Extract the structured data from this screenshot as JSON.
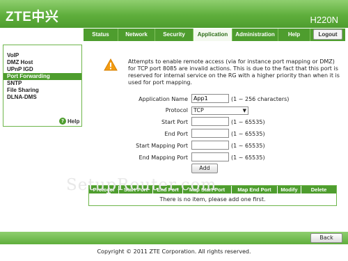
{
  "header": {
    "logo": "ZTE中兴",
    "model": "H220N"
  },
  "nav": {
    "tabs": [
      "Status",
      "Network",
      "Security",
      "Application",
      "Administration",
      "Help"
    ],
    "active": "Application",
    "logout": "Logout"
  },
  "sidebar": {
    "items": [
      "VoIP",
      "DMZ Host",
      "UPnP IGD",
      "Port Forwarding",
      "SNTP",
      "File Sharing",
      "DLNA-DMS"
    ],
    "active": "Port Forwarding",
    "help": "Help"
  },
  "warning": {
    "text": "Attempts to enable remote access (via for instance port mapping or DMZ) for TCP port 8085 are invalid actions. This is due to the fact that this port is reserved for internal service on the RG with a higher priority than when it is used for port mapping."
  },
  "form": {
    "app_name_label": "Application Name",
    "app_name_value": "App1",
    "app_name_hint": "(1 ~ 256 characters)",
    "protocol_label": "Protocol",
    "protocol_value": "TCP",
    "start_port_label": "Start Port",
    "start_port_value": "",
    "start_port_hint": "(1 ~ 65535)",
    "end_port_label": "End Port",
    "end_port_value": "",
    "end_port_hint": "(1 ~ 65535)",
    "start_map_label": "Start Mapping Port",
    "start_map_value": "",
    "start_map_hint": "(1 ~ 65535)",
    "end_map_label": "End Mapping Port",
    "end_map_value": "",
    "end_map_hint": "(1 ~ 65535)",
    "add_button": "Add"
  },
  "table": {
    "columns": [
      "Protocol",
      "Start Port",
      "End Port",
      "Map Start Port",
      "Map End Port",
      "Modify",
      "Delete"
    ],
    "empty_message": "There is no item, please add one first."
  },
  "watermark": "SetupRouter.com",
  "footer": {
    "back_button": "Back",
    "copyright": "Copyright © 2011 ZTE Corporation. All rights reserved."
  },
  "colors": {
    "brand_green": "#4e9d2e",
    "warning_orange": "#f39c12"
  }
}
